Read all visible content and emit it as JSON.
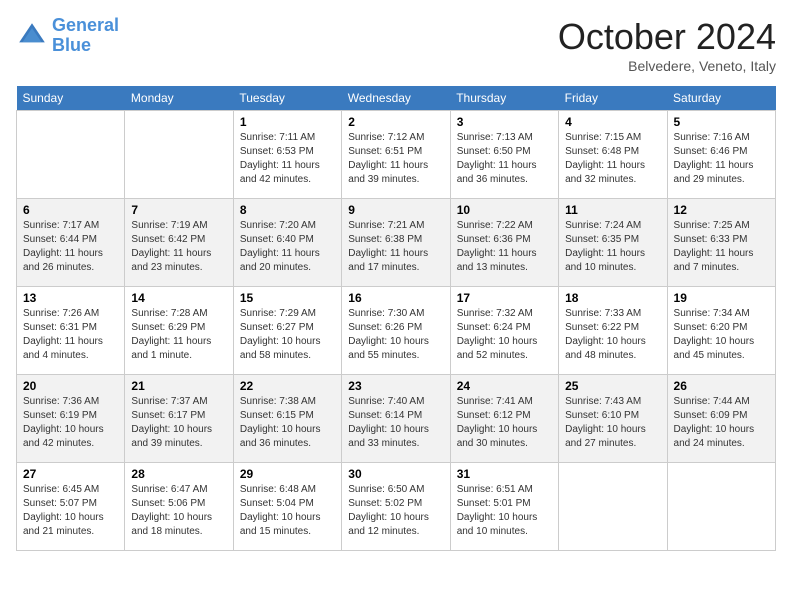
{
  "header": {
    "logo_general": "General",
    "logo_blue": "Blue",
    "month_title": "October 2024",
    "location": "Belvedere, Veneto, Italy"
  },
  "days_of_week": [
    "Sunday",
    "Monday",
    "Tuesday",
    "Wednesday",
    "Thursday",
    "Friday",
    "Saturday"
  ],
  "weeks": [
    [
      {
        "day": "",
        "info": ""
      },
      {
        "day": "",
        "info": ""
      },
      {
        "day": "1",
        "info": "Sunrise: 7:11 AM\nSunset: 6:53 PM\nDaylight: 11 hours and 42 minutes."
      },
      {
        "day": "2",
        "info": "Sunrise: 7:12 AM\nSunset: 6:51 PM\nDaylight: 11 hours and 39 minutes."
      },
      {
        "day": "3",
        "info": "Sunrise: 7:13 AM\nSunset: 6:50 PM\nDaylight: 11 hours and 36 minutes."
      },
      {
        "day": "4",
        "info": "Sunrise: 7:15 AM\nSunset: 6:48 PM\nDaylight: 11 hours and 32 minutes."
      },
      {
        "day": "5",
        "info": "Sunrise: 7:16 AM\nSunset: 6:46 PM\nDaylight: 11 hours and 29 minutes."
      }
    ],
    [
      {
        "day": "6",
        "info": "Sunrise: 7:17 AM\nSunset: 6:44 PM\nDaylight: 11 hours and 26 minutes."
      },
      {
        "day": "7",
        "info": "Sunrise: 7:19 AM\nSunset: 6:42 PM\nDaylight: 11 hours and 23 minutes."
      },
      {
        "day": "8",
        "info": "Sunrise: 7:20 AM\nSunset: 6:40 PM\nDaylight: 11 hours and 20 minutes."
      },
      {
        "day": "9",
        "info": "Sunrise: 7:21 AM\nSunset: 6:38 PM\nDaylight: 11 hours and 17 minutes."
      },
      {
        "day": "10",
        "info": "Sunrise: 7:22 AM\nSunset: 6:36 PM\nDaylight: 11 hours and 13 minutes."
      },
      {
        "day": "11",
        "info": "Sunrise: 7:24 AM\nSunset: 6:35 PM\nDaylight: 11 hours and 10 minutes."
      },
      {
        "day": "12",
        "info": "Sunrise: 7:25 AM\nSunset: 6:33 PM\nDaylight: 11 hours and 7 minutes."
      }
    ],
    [
      {
        "day": "13",
        "info": "Sunrise: 7:26 AM\nSunset: 6:31 PM\nDaylight: 11 hours and 4 minutes."
      },
      {
        "day": "14",
        "info": "Sunrise: 7:28 AM\nSunset: 6:29 PM\nDaylight: 11 hours and 1 minute."
      },
      {
        "day": "15",
        "info": "Sunrise: 7:29 AM\nSunset: 6:27 PM\nDaylight: 10 hours and 58 minutes."
      },
      {
        "day": "16",
        "info": "Sunrise: 7:30 AM\nSunset: 6:26 PM\nDaylight: 10 hours and 55 minutes."
      },
      {
        "day": "17",
        "info": "Sunrise: 7:32 AM\nSunset: 6:24 PM\nDaylight: 10 hours and 52 minutes."
      },
      {
        "day": "18",
        "info": "Sunrise: 7:33 AM\nSunset: 6:22 PM\nDaylight: 10 hours and 48 minutes."
      },
      {
        "day": "19",
        "info": "Sunrise: 7:34 AM\nSunset: 6:20 PM\nDaylight: 10 hours and 45 minutes."
      }
    ],
    [
      {
        "day": "20",
        "info": "Sunrise: 7:36 AM\nSunset: 6:19 PM\nDaylight: 10 hours and 42 minutes."
      },
      {
        "day": "21",
        "info": "Sunrise: 7:37 AM\nSunset: 6:17 PM\nDaylight: 10 hours and 39 minutes."
      },
      {
        "day": "22",
        "info": "Sunrise: 7:38 AM\nSunset: 6:15 PM\nDaylight: 10 hours and 36 minutes."
      },
      {
        "day": "23",
        "info": "Sunrise: 7:40 AM\nSunset: 6:14 PM\nDaylight: 10 hours and 33 minutes."
      },
      {
        "day": "24",
        "info": "Sunrise: 7:41 AM\nSunset: 6:12 PM\nDaylight: 10 hours and 30 minutes."
      },
      {
        "day": "25",
        "info": "Sunrise: 7:43 AM\nSunset: 6:10 PM\nDaylight: 10 hours and 27 minutes."
      },
      {
        "day": "26",
        "info": "Sunrise: 7:44 AM\nSunset: 6:09 PM\nDaylight: 10 hours and 24 minutes."
      }
    ],
    [
      {
        "day": "27",
        "info": "Sunrise: 6:45 AM\nSunset: 5:07 PM\nDaylight: 10 hours and 21 minutes."
      },
      {
        "day": "28",
        "info": "Sunrise: 6:47 AM\nSunset: 5:06 PM\nDaylight: 10 hours and 18 minutes."
      },
      {
        "day": "29",
        "info": "Sunrise: 6:48 AM\nSunset: 5:04 PM\nDaylight: 10 hours and 15 minutes."
      },
      {
        "day": "30",
        "info": "Sunrise: 6:50 AM\nSunset: 5:02 PM\nDaylight: 10 hours and 12 minutes."
      },
      {
        "day": "31",
        "info": "Sunrise: 6:51 AM\nSunset: 5:01 PM\nDaylight: 10 hours and 10 minutes."
      },
      {
        "day": "",
        "info": ""
      },
      {
        "day": "",
        "info": ""
      }
    ]
  ]
}
